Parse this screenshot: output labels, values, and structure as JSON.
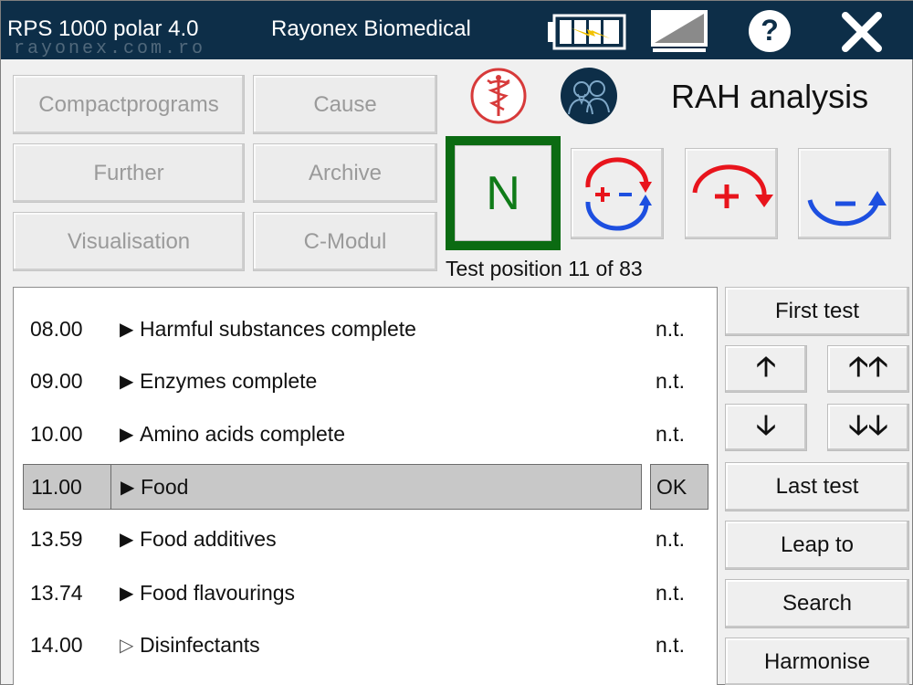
{
  "titlebar": {
    "app_title": "RPS 1000 polar 4.0",
    "vendor": "Rayonex Biomedical",
    "watermark": "rayonex.com.ro"
  },
  "menu": {
    "compactprograms": "Compactprograms",
    "cause": "Cause",
    "further": "Further",
    "archive": "Archive",
    "visualisation": "Visualisation",
    "c_modul": "C-Modul"
  },
  "mode": {
    "title": "RAH analysis",
    "n_label": "N",
    "test_position": "Test position 11 of 83"
  },
  "list": {
    "rows": [
      {
        "num": "08.00",
        "name": "Harmful substances complete",
        "status": "n.t."
      },
      {
        "num": "09.00",
        "name": "Enzymes complete",
        "status": "n.t."
      },
      {
        "num": "10.00",
        "name": "Amino acids complete",
        "status": "n.t."
      },
      {
        "num": "11.00",
        "name": "Food",
        "status": "OK"
      },
      {
        "num": "13.59",
        "name": "Food additives",
        "status": "n.t."
      },
      {
        "num": "13.74",
        "name": "Food flavourings",
        "status": "n.t."
      },
      {
        "num": "14.00",
        "name": "Disinfectants",
        "status": "n.t."
      }
    ],
    "triangle_filled": "▶",
    "triangle_outline": "▷"
  },
  "side": {
    "first_test": "First test",
    "up": "🡡",
    "up_fast": "🡡🡡",
    "down": "🡣",
    "down_fast": "🡣🡣",
    "last_test": "Last test",
    "leap_to": "Leap to",
    "search": "Search",
    "harmonise": "Harmonise"
  },
  "colors": {
    "titlebar": "#0d2e48",
    "n_frame": "#0b6b12",
    "plus_red": "#e8141c",
    "minus_blue": "#1d4fe0"
  },
  "icons": [
    "battery-charging-icon",
    "monitor-icon",
    "help-icon",
    "close-icon",
    "caduceus-icon",
    "therapist-patient-icon"
  ]
}
